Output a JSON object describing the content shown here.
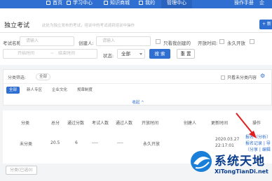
{
  "nav": {
    "items": [
      "首页",
      "学习中心",
      "知识商城",
      "我的"
    ],
    "active": "管理中心",
    "ops": "操作手册",
    "ops2": "企"
  },
  "header": {
    "title": "独立考试",
    "desc": "此处为独立发布的考试，培训中的考试请到培训中操作",
    "new_btn": "+ 新"
  },
  "filters": {
    "name_label": "考试名称:",
    "name_placeholder": "请输入",
    "creator_label": "创建人:",
    "creator_placeholder": "请输入",
    "mine_label": "只看我创建的",
    "open_label": "开放时间:",
    "forever_label": "永久开放",
    "start_placeholder": "开始时间",
    "end_placeholder": "结束时间",
    "sep": "~",
    "status_label": "状态:",
    "status_value": "全部",
    "search_btn": "搜 索",
    "reset_btn": "重 置"
  },
  "category": {
    "label": "分类筛选:",
    "chip": "全部",
    "only_label": "只看未分类内容",
    "tabs": [
      "全部",
      "新人专区",
      "企业文化",
      "规章制度"
    ],
    "collapse": "收起 ^"
  },
  "table": {
    "headers": [
      "分类",
      "总分",
      "通过分数",
      "考试人数",
      "通过人数",
      "开放时间",
      "创建人",
      "更新时间",
      "操作"
    ],
    "rows": [
      {
        "category": "未分类",
        "total": "20.5",
        "pass": "6",
        "examinees": "----",
        "passed": "----",
        "open": "永久开放",
        "creator": "",
        "updated": "2020.03.27 22:17:01",
        "ops": [
          "报名（分析）",
          "报名记录 | 导",
          "（分享 | 编辑"
        ]
      }
    ]
  },
  "footer": {
    "btn": "分类(已选0)"
  },
  "watermark": {
    "title": "系统天地",
    "url": "XiTongTianDi.net"
  },
  "colors": {
    "primary": "#2f6fd1",
    "arrow": "#e02020"
  }
}
